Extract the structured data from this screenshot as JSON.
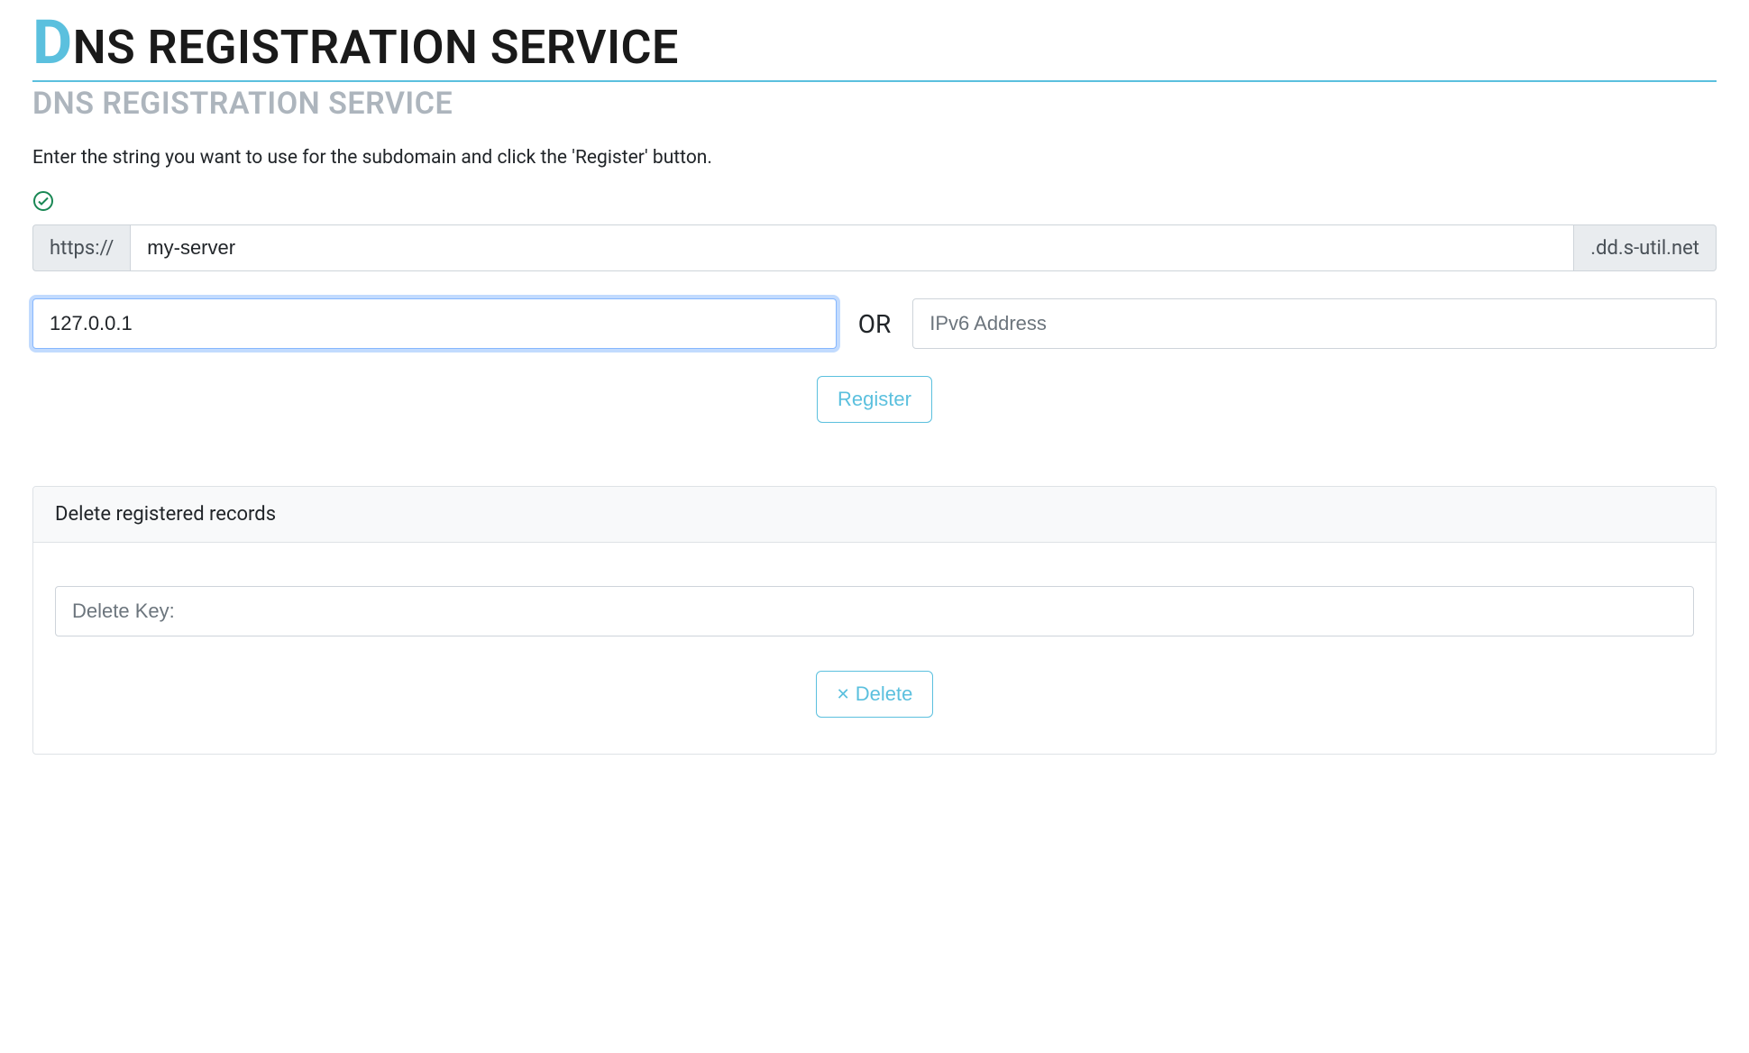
{
  "header": {
    "title_first_letter": "D",
    "title_rest": "NS REGISTRATION SERVICE",
    "subtitle": "DNS REGISTRATION SERVICE"
  },
  "instructions": "Enter the string you want to use for the subdomain and click the 'Register' button.",
  "subdomain": {
    "prefix": "https://",
    "value": "my-server",
    "suffix": ".dd.s-util.net"
  },
  "ipv4": {
    "value": "127.0.0.1"
  },
  "or_label": "OR",
  "ipv6": {
    "placeholder": "IPv6 Address",
    "value": ""
  },
  "register_button": "Register",
  "delete_panel": {
    "header": "Delete registered records",
    "placeholder": "Delete Key:",
    "value": "",
    "button": "Delete"
  },
  "icons": {
    "check_color": "#198754",
    "accent_color": "#5bc0de"
  }
}
